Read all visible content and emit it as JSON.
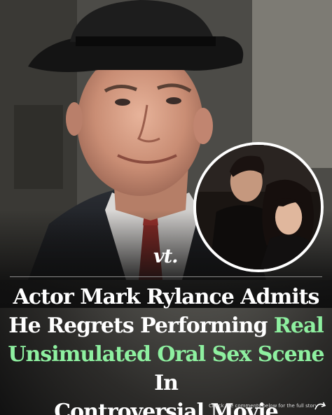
{
  "logo": {
    "text": "vt."
  },
  "headline": {
    "part1": "Actor Mark Rylance Admits",
    "part2": "He Regrets Performing ",
    "highlight1": "Real",
    "highlight2": "Unsimulated Oral Sex Scene",
    "part3": " In",
    "part4": "Controversial Movie",
    "highlight_color": "#8ef0a0"
  },
  "footer": {
    "text": "Check the comments below for the full story"
  },
  "icons": {
    "footer_arrow": "curved-arrow-icon"
  }
}
